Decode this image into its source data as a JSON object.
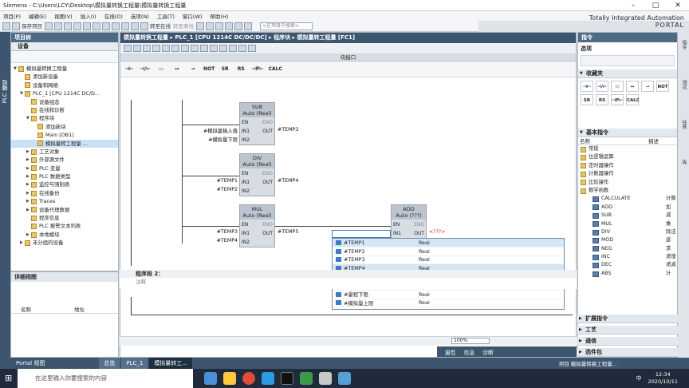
{
  "window": {
    "title": "Siemens  -  C:\\Users\\LCY\\Desktop\\模拟量转换工程量\\模拟量转换工程量"
  },
  "brand": {
    "line1": "Totally Integrated Automation",
    "line2": "PORTAL"
  },
  "menu": [
    "项目(P)",
    "编辑(E)",
    "视图(V)",
    "插入(I)",
    "在线(O)",
    "选项(N)",
    "工具(T)",
    "窗口(W)",
    "帮助(H)"
  ],
  "toolbar": {
    "save": "保存项目",
    "online": "转至在线",
    "offline": "转至离线",
    "search_placeholder": "<在项目中搜索>"
  },
  "left_strip": "PLC 编程",
  "project": {
    "title": "项目树",
    "devices_tab": "设备",
    "items": [
      {
        "label": "模拟量转换工程量",
        "indent": 0,
        "arrow": "▼"
      },
      {
        "label": "添加新设备",
        "indent": 1,
        "arrow": ""
      },
      {
        "label": "设备和网络",
        "indent": 1,
        "arrow": ""
      },
      {
        "label": "PLC_1 [CPU 1214C DC/D...",
        "indent": 1,
        "arrow": "▼"
      },
      {
        "label": "设备组态",
        "indent": 2,
        "arrow": ""
      },
      {
        "label": "在线和诊断",
        "indent": 2,
        "arrow": ""
      },
      {
        "label": "程序块",
        "indent": 2,
        "arrow": "▼"
      },
      {
        "label": "添加新块",
        "indent": 3,
        "arrow": ""
      },
      {
        "label": "Main [OB1]",
        "indent": 3,
        "arrow": ""
      },
      {
        "label": "模拟量转工程量 ...",
        "indent": 3,
        "arrow": "",
        "sel": true
      },
      {
        "label": "工艺对象",
        "indent": 2,
        "arrow": "▶"
      },
      {
        "label": "外部源文件",
        "indent": 2,
        "arrow": "▶"
      },
      {
        "label": "PLC 变量",
        "indent": 2,
        "arrow": "▶"
      },
      {
        "label": "PLC 数据类型",
        "indent": 2,
        "arrow": "▶"
      },
      {
        "label": "监控与强制表",
        "indent": 2,
        "arrow": "▶"
      },
      {
        "label": "在线备份",
        "indent": 2,
        "arrow": "▶"
      },
      {
        "label": "Traces",
        "indent": 2,
        "arrow": "▶"
      },
      {
        "label": "设备代理数据",
        "indent": 2,
        "arrow": "▶"
      },
      {
        "label": "程序信息",
        "indent": 2,
        "arrow": ""
      },
      {
        "label": "PLC 报警文本列表",
        "indent": 2,
        "arrow": ""
      },
      {
        "label": "本地模块",
        "indent": 2,
        "arrow": "▶"
      },
      {
        "label": "未分组的设备",
        "indent": 1,
        "arrow": "▶"
      }
    ]
  },
  "details": {
    "title": "详细视图",
    "col_name": "名称",
    "col_addr": "地址"
  },
  "editor": {
    "breadcrumb": "模拟量转换工程量 ▸ PLC_1 [CPU 1214C DC/DC/DC] ▸ 程序块 ▸ 模拟量转工程量 [FC1]",
    "block_interface": "块接口",
    "instr_buttons": [
      "⊣⊢",
      "⊣/⊢",
      "▭",
      "↦",
      "⊸",
      "NOT",
      "SR",
      "RS",
      "⊣P⊢",
      "CALC"
    ],
    "blocks": [
      {
        "name": "SUB",
        "type": "Auto (Real)",
        "in1": "#模拟量输入值",
        "in2": "#模拟量下限",
        "out": "#TEMP3"
      },
      {
        "name": "DIV",
        "type": "Auto (Real)",
        "in1": "#TEMP1",
        "in2": "#TEMP2",
        "out": "#TEMP4"
      },
      {
        "name": "MUL",
        "type": "Auto (Real)",
        "in1": "#TEMP3",
        "in2": "#TEMP4",
        "out": "#TEMP5"
      },
      {
        "name": "ADD",
        "type": "Auto (???)",
        "in1": "",
        "in2": "",
        "out": "<???>"
      }
    ],
    "pins": {
      "en": "EN",
      "eno": "ENO",
      "in1": "IN1",
      "in2": "IN2",
      "out": "OUT"
    },
    "network2_label": "程序段 2：",
    "network2_comment": "注释",
    "zoom": "100%",
    "prop_tabs": [
      "属性",
      "信息",
      "诊断"
    ]
  },
  "autocomplete": [
    {
      "name": "#TEMP1",
      "type": "Real",
      "sel": true
    },
    {
      "name": "#TEMP2",
      "type": "Real"
    },
    {
      "name": "#TEMP3",
      "type": "Real"
    },
    {
      "name": "#TEMP4",
      "type": "Real",
      "sel": true
    },
    {
      "name": "#TEMP5",
      "type": "Real"
    },
    {
      "name": "#量程上限",
      "type": "Real"
    },
    {
      "name": "#量程下限",
      "type": "Real"
    },
    {
      "name": "#模拟量上限",
      "type": "Real"
    }
  ],
  "right": {
    "title": "指令",
    "options": "选项",
    "favorites": "收藏夹",
    "fav_items": [
      "⊣⊢",
      "⊣/⊢",
      "▭",
      "↦",
      "⊸",
      "NOT",
      "SR",
      "RS",
      "⊣P⊢",
      "CALC"
    ],
    "basic": "基本指令",
    "col_name": "名称",
    "col_desc": "描述",
    "items": [
      {
        "label": "常规",
        "desc": "",
        "folder": true
      },
      {
        "label": "位逻辑运算",
        "desc": "",
        "folder": true
      },
      {
        "label": "定时器操作",
        "desc": "",
        "folder": true
      },
      {
        "label": "计数器操作",
        "desc": "",
        "folder": true
      },
      {
        "label": "比较操作",
        "desc": "",
        "folder": true
      },
      {
        "label": "数学函数",
        "desc": "",
        "folder": true
      },
      {
        "label": "CALCULATE",
        "desc": "计算"
      },
      {
        "label": "ADD",
        "desc": "加"
      },
      {
        "label": "SUB",
        "desc": "减"
      },
      {
        "label": "MUL",
        "desc": "乘"
      },
      {
        "label": "DIV",
        "desc": "除法"
      },
      {
        "label": "MOD",
        "desc": "返"
      },
      {
        "label": "NEG",
        "desc": "求"
      },
      {
        "label": "INC",
        "desc": "递增"
      },
      {
        "label": "DEC",
        "desc": "递减"
      },
      {
        "label": "ABS",
        "desc": "计"
      }
    ],
    "sections": [
      "扩展指令",
      "工艺",
      "通信",
      "选件包"
    ],
    "strip": [
      "指令",
      "测试",
      "任务",
      "库"
    ]
  },
  "portal": {
    "label": "Portal 视图",
    "tabs": [
      "总览",
      "PLC_1",
      "模拟量转工..."
    ],
    "status": "项目 模拟量转换工程量..."
  },
  "taskbar": {
    "search": "在这里输入你要搜索的内容",
    "time": "12:34",
    "date": "2020/10/11",
    "ime": "中"
  }
}
